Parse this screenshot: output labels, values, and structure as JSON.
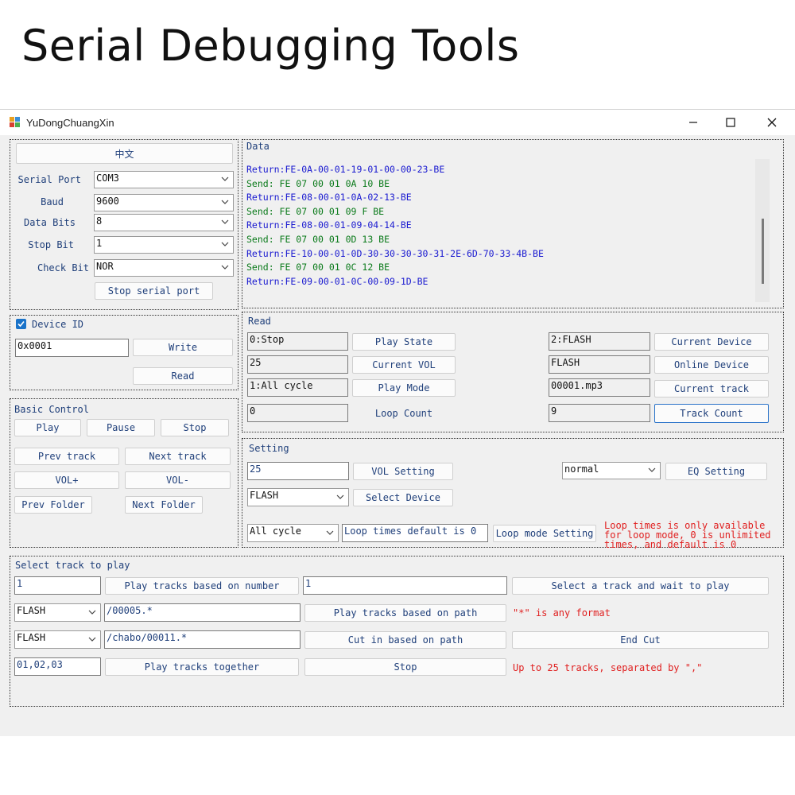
{
  "page_title": "Serial Debugging Tools",
  "window": {
    "title": "YuDongChuangXin"
  },
  "serial": {
    "language_button": "中文",
    "serial_port_label": "Serial Port",
    "serial_port_value": "COM3",
    "baud_label": "Baud",
    "baud_value": "9600",
    "data_bits_label": "Data Bits",
    "data_bits_value": "8",
    "stop_bit_label": "Stop Bit",
    "stop_bit_value": "1",
    "check_bit_label": "Check Bit",
    "check_bit_value": "NOR",
    "stop_serial_button": "Stop serial port"
  },
  "device": {
    "label": "Device ID",
    "checked": true,
    "id_value": "0x0001",
    "write_button": "Write",
    "read_button": "Read"
  },
  "basic": {
    "label": "Basic Control",
    "play": "Play",
    "pause": "Pause",
    "stop": "Stop",
    "prev_track": "Prev track",
    "next_track": "Next track",
    "vol_up": "VOL+",
    "vol_down": "VOL-",
    "prev_folder": "Prev Folder",
    "next_folder": "Next Folder"
  },
  "data_log": {
    "label": "Data",
    "lines": [
      {
        "type": "return",
        "text": "Return:FE-0A-00-01-19-01-00-00-23-BE"
      },
      {
        "type": "send",
        "text": "Send: FE 07 00 01 0A 10 BE"
      },
      {
        "type": "return",
        "text": "Return:FE-08-00-01-0A-02-13-BE"
      },
      {
        "type": "send",
        "text": "Send: FE 07 00 01 09 F BE"
      },
      {
        "type": "return",
        "text": "Return:FE-08-00-01-09-04-14-BE"
      },
      {
        "type": "send",
        "text": "Send: FE 07 00 01 0D 13 BE"
      },
      {
        "type": "return",
        "text": "Return:FE-10-00-01-0D-30-30-30-30-31-2E-6D-70-33-4B-BE"
      },
      {
        "type": "send",
        "text": "Send: FE 07 00 01 0C 12 BE"
      },
      {
        "type": "return",
        "text": "Return:FE-09-00-01-0C-00-09-1D-BE"
      }
    ]
  },
  "read": {
    "label": "Read",
    "play_state_value": "0:Stop",
    "play_state_button": "Play State",
    "current_vol_value": "25",
    "current_vol_button": "Current VOL",
    "play_mode_value": "1:All cycle",
    "play_mode_button": "Play Mode",
    "loop_count_value": "0",
    "loop_count_label": "Loop Count",
    "current_device_value": "2:FLASH",
    "current_device_button": "Current Device",
    "online_device_value": "FLASH",
    "online_device_button": "Online Device",
    "current_track_value": "00001.mp3",
    "current_track_button": "Current track",
    "track_count_value": "9",
    "track_count_button": "Track Count"
  },
  "setting": {
    "label": "Setting",
    "vol_value": "25",
    "vol_button": "VOL Setting",
    "eq_value": "normal",
    "eq_button": "EQ Setting",
    "device_value": "FLASH",
    "device_button": "Select Device",
    "loop_mode_value": "All cycle",
    "loop_times_value": "Loop times default is 0",
    "loop_mode_button": "Loop mode Setting",
    "note_line1": "Loop times is only available",
    "note_line2": "for loop mode, 0 is unlimited",
    "note_line3": "times, and default is 0"
  },
  "select_track": {
    "label": "Select track to play",
    "number_value": "1",
    "play_by_number_button": "Play tracks based on number",
    "wait_value": "1",
    "select_wait_button": "Select a track and wait to play",
    "path_device_value": "FLASH",
    "path_value": "/00005.*",
    "play_by_path_button": "Play tracks based on path",
    "path_note": "\"*\" is any format",
    "cut_device_value": "FLASH",
    "cut_path_value": "/chabo/00011.*",
    "cut_in_button": "Cut in based on path",
    "end_cut_button": "End Cut",
    "together_value": "01,02,03",
    "play_together_button": "Play tracks together",
    "stop_button": "Stop",
    "together_note": "Up to 25 tracks, separated by \",\""
  },
  "colors": {
    "label_blue": "#1f3f7a",
    "return_blue": "#1a1ad0",
    "send_green": "#0a7a1a",
    "note_red": "#e02020",
    "checkbox_blue": "#1a73c9"
  }
}
